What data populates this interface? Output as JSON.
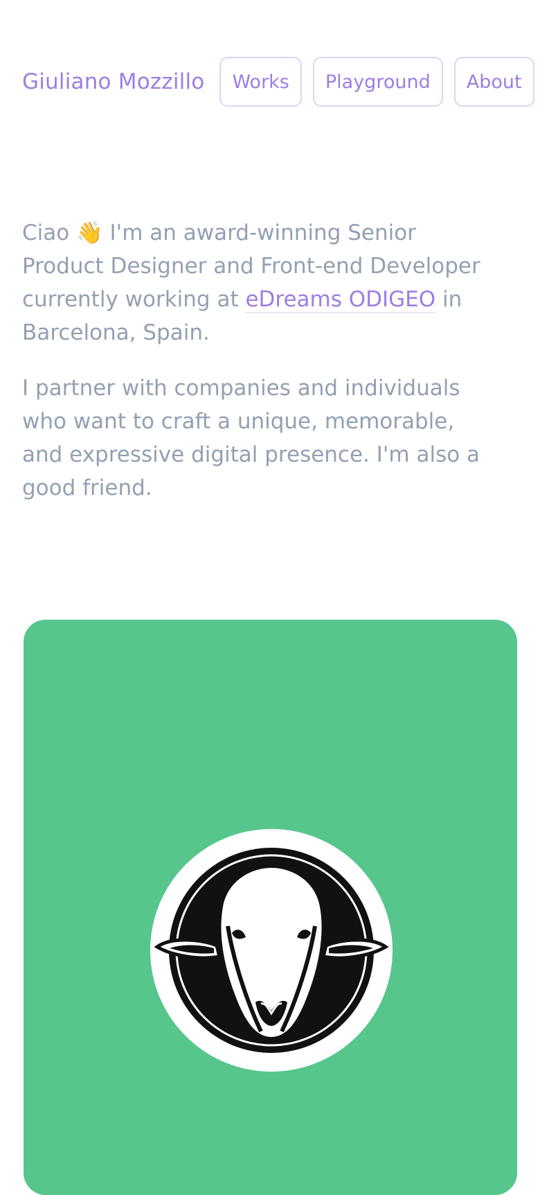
{
  "header": {
    "site_name": "Giuliano Mozzillo",
    "nav": [
      {
        "label": "Works"
      },
      {
        "label": "Playground"
      },
      {
        "label": "About"
      }
    ]
  },
  "intro": {
    "p1_before": "Ciao ",
    "wave_emoji": "👋",
    "p1_middle": " I'm an award-winning Senior Product Designer and Front-end Developer currently working at ",
    "company_link": "eDreams ODIGEO",
    "p1_after": " in Barcelona, Spain.",
    "p2": "I partner with companies and individuals who want to craft a unique, memorable, and expressive digital presence. I'm also a good friend."
  },
  "colors": {
    "accent": "#9b7ee3",
    "body_text": "#93a0b2",
    "card_background": "#57c68c"
  },
  "icons": {
    "card_logo": "sheep-logo-icon"
  }
}
